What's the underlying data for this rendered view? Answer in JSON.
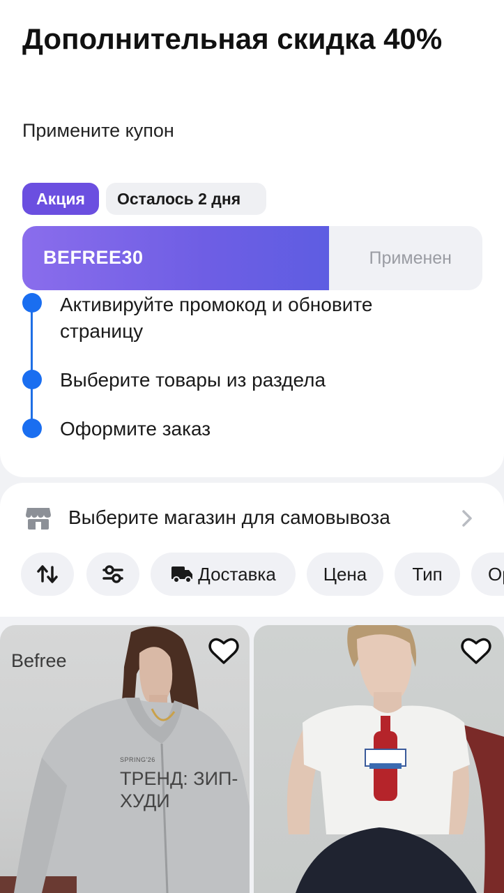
{
  "promo": {
    "title": "Дополнительная скидка 40%",
    "subtitle": "Примените купон",
    "badge_sale": "Акция",
    "badge_days": "Осталось 2 дня",
    "coupon_code": "BEFREE30",
    "coupon_status": "Применен",
    "steps": [
      "Активируйте промокод и обновите страницу",
      "Выберите товары из раздела",
      "Оформите заказ"
    ]
  },
  "store": {
    "label": "Выберите магазин для самовывоза",
    "icon": "store-icon"
  },
  "filters": {
    "sort_icon": "sort-arrows-icon",
    "settings_icon": "filter-sliders-icon",
    "delivery_icon": "delivery-truck-icon",
    "delivery": "Доставка",
    "price": "Цена",
    "type": "Тип",
    "partial": "Ор"
  },
  "products": [
    {
      "brand": "Befree",
      "season": "SPRING'26",
      "trend": "ТРЕНД: ЗИП-ХУДИ"
    },
    {}
  ],
  "colors": {
    "accent_purple": "#6b4fe0",
    "step_blue": "#1a6ef0",
    "chip_bg": "#f0f1f5"
  }
}
